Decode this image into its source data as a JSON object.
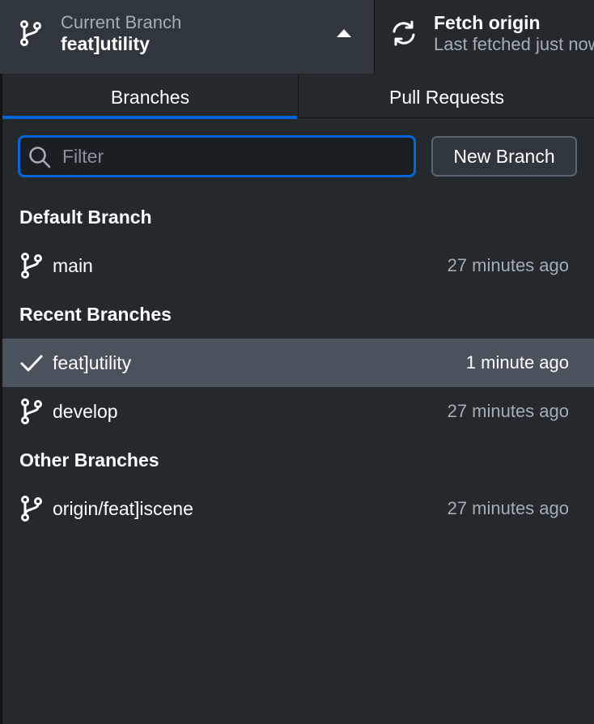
{
  "toolbar": {
    "current_branch": {
      "title": "Current Branch",
      "name": "feat]utility"
    },
    "fetch": {
      "title": "Fetch origin",
      "subtitle": "Last fetched just now"
    }
  },
  "tabs": [
    {
      "label": "Branches",
      "selected": true
    },
    {
      "label": "Pull Requests",
      "selected": false
    }
  ],
  "filter": {
    "placeholder": "Filter",
    "value": ""
  },
  "new_branch_label": "New Branch",
  "groups": {
    "default": {
      "header": "Default Branch",
      "items": [
        {
          "name": "main",
          "time": "27 minutes ago",
          "icon": "git-branch-icon"
        }
      ]
    },
    "recent": {
      "header": "Recent Branches",
      "items": [
        {
          "name": "feat]utility",
          "time": "1 minute ago",
          "icon": "check-icon",
          "selected": true
        },
        {
          "name": "develop",
          "time": "27 minutes ago",
          "icon": "git-branch-icon"
        }
      ]
    },
    "other": {
      "header": "Other Branches",
      "items": [
        {
          "name": "origin/feat]iscene",
          "time": "27 minutes ago",
          "icon": "git-branch-icon"
        }
      ]
    }
  },
  "colors": {
    "background": "#24292e",
    "accent": "#0366d6",
    "selected_row": "#4a525c",
    "muted_text": "#a4adb6"
  }
}
